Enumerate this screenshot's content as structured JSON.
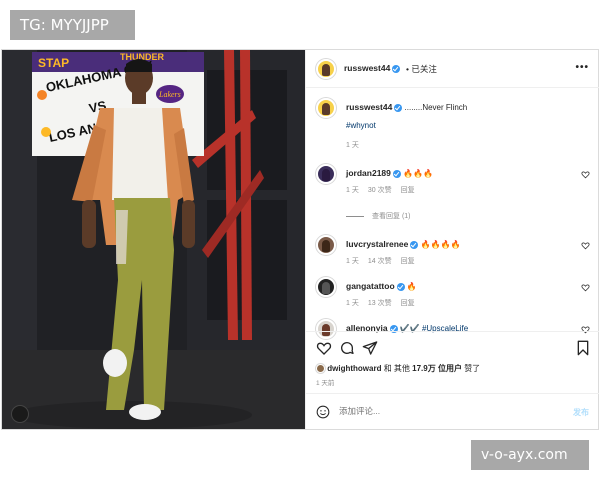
{
  "watermarks": {
    "top_left": "TG: MYYJJPP",
    "bottom_right": "v-o-ayx.com"
  },
  "photo": {
    "sign_text_1": "STAP",
    "sign_text_2": "OKLAHOMA CITY",
    "sign_text_3": "THUNDER",
    "sign_text_4": "VS",
    "sign_text_5": "LOS ANGELES",
    "sign_text_6": "Lakers"
  },
  "header": {
    "username": "russwest44",
    "follow_label": "• 已关注",
    "more_label": "•••"
  },
  "caption": {
    "username": "russwest44",
    "text": "........Never Flinch",
    "hashtag": "#whynot",
    "time": "1 天"
  },
  "comments": [
    {
      "username": "jordan2189",
      "text": "🔥🔥🔥",
      "time": "1 天",
      "likes": "30 次赞",
      "reply": "回复"
    },
    {
      "username": "luvcrystalrenee",
      "text": "🔥🔥🔥🔥",
      "time": "1 天",
      "likes": "14 次赞",
      "reply": "回复"
    },
    {
      "username": "gangatattoo",
      "text": "🔥",
      "time": "1 天",
      "likes": "13 次赞",
      "reply": "回复"
    },
    {
      "username": "allenonyia",
      "text": "✔️✔️ #UpscaleLife"
    }
  ],
  "view_replies": "查看回复 (1)",
  "likes": {
    "user": "dwighthoward",
    "connector": "和 其他",
    "count": "17.9万 位用户",
    "suffix": "赞了"
  },
  "post_age": "1 天前",
  "add_comment": {
    "placeholder": "添加评论...",
    "post_label": "发布"
  }
}
